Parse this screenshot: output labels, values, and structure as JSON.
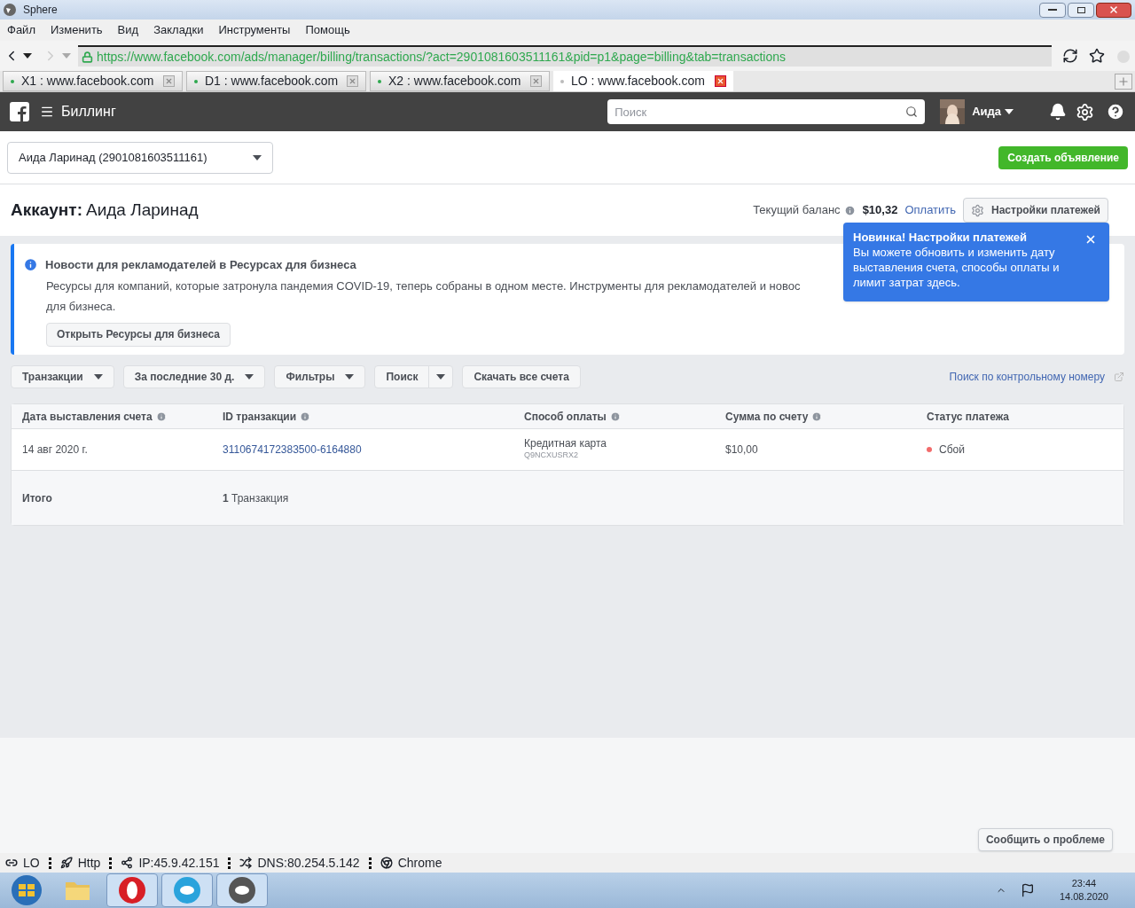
{
  "window": {
    "title": "Sphere"
  },
  "menu": [
    "Файл",
    "Изменить",
    "Вид",
    "Закладки",
    "Инструменты",
    "Помощь"
  ],
  "address": {
    "url": "https://www.facebook.com/ads/manager/billing/transactions/?act=2901081603511161&pid=p1&page=billing&tab=transactions"
  },
  "tabs": [
    {
      "label": "X1 : www.facebook.com",
      "selected": false
    },
    {
      "label": "D1 : www.facebook.com",
      "selected": false
    },
    {
      "label": "X2 : www.facebook.com",
      "selected": false
    },
    {
      "label": "LO : www.facebook.com",
      "selected": true
    }
  ],
  "header": {
    "title": "Биллинг",
    "search": {
      "placeholder": "Поиск"
    },
    "user": "Аида"
  },
  "account_select": {
    "value": "Аида Ларинад (2901081603511161)"
  },
  "create_button": "Создать объявление",
  "account": {
    "label": "Аккаунт:",
    "name": "Аида Ларинад",
    "balance_label": "Текущий баланс",
    "balance": "$10,32",
    "pay_link": "Оплатить",
    "settings_button": "Настройки платежей"
  },
  "tooltip": {
    "title": "Новинка! Настройки платежей",
    "text": "Вы можете обновить и изменить дату выставления счета, способы оплаты и лимит затрат здесь."
  },
  "banner": {
    "title": "Новости для рекламодателей в Ресурсах для бизнеса",
    "lines": [
      "Ресурсы для компаний, которые затронула пандемия COVID-19, теперь собраны в одном месте. Инструменты для рекламодателей и новос",
      "для бизнеса."
    ],
    "button": "Открыть Ресурсы для бизнеса"
  },
  "toolbar": [
    {
      "label": "Транзакции",
      "kind": "dropdown"
    },
    {
      "label": "За последние 30 д.",
      "kind": "dropdown"
    },
    {
      "label": "Фильтры",
      "kind": "dropdown"
    },
    {
      "label": "Поиск",
      "kind": "split"
    },
    {
      "label": "Скачать все счета",
      "kind": "plain"
    }
  ],
  "lookup_link": "Поиск по контрольному номеру",
  "table": {
    "columns": [
      {
        "label": "Дата выставления счета",
        "info": true
      },
      {
        "label": "ID транзакции",
        "info": true
      },
      {
        "label": "Способ оплаты",
        "info": true
      },
      {
        "label": "Сумма по счету",
        "info": true
      },
      {
        "label": "Статус платежа",
        "info": false
      }
    ],
    "rows": [
      {
        "date": "14 авг 2020 г.",
        "id": "3110674172383500-6164880",
        "method": "Кредитная карта",
        "method_code": "Q9NCXUSRX2",
        "amount": "$10,00",
        "status": "Сбой",
        "color": "#f26b6b"
      }
    ],
    "total": {
      "label": "Итого",
      "count": "1",
      "count_label": "Транзакция"
    }
  },
  "report_button": "Сообщить о проблеме",
  "status_bar": [
    "LO",
    "Http",
    "IP:45.9.42.151",
    "DNS:80.254.5.142",
    "Chrome"
  ],
  "taskbar": {
    "time": "23:44",
    "date": "14.08.2020"
  }
}
